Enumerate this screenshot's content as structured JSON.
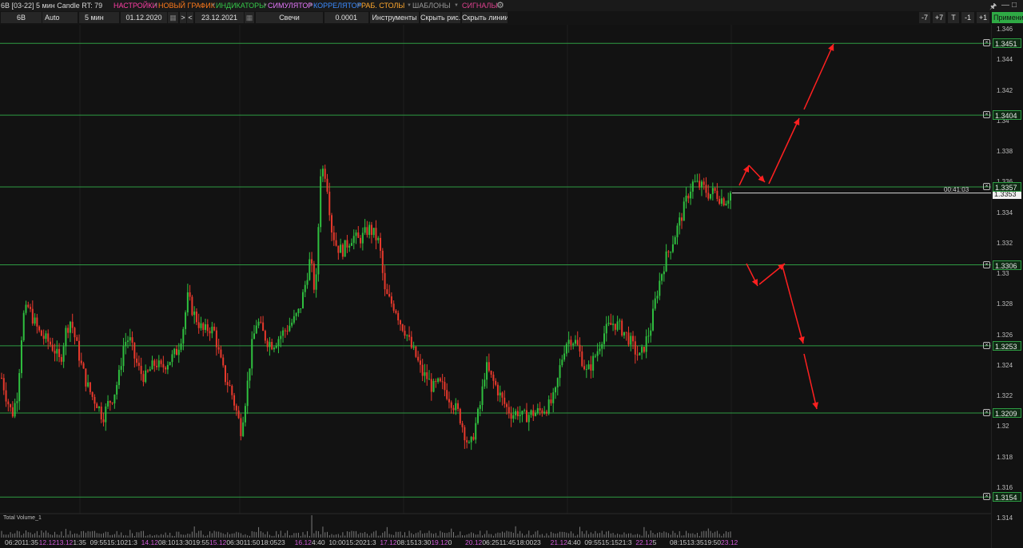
{
  "menubar": {
    "instrument_title": "6B [03-22] 5 мин Candle RT: 79",
    "items": [
      {
        "label": "НАСТРОЙКИ",
        "color": "#ff3ea5"
      },
      {
        "label": "НОВЫЙ ГРАФИК",
        "color": "#ff7a1a"
      },
      {
        "label": "ИНДИКАТОРЫ",
        "color": "#35c84a"
      },
      {
        "label": "СИМУЛЯТОР",
        "color": "#e879ff"
      },
      {
        "label": "КОРРЕЛЯТОР",
        "color": "#3c8cff"
      },
      {
        "label": "РАБ. СТОЛЫ",
        "color": "#ffa82e"
      },
      {
        "label": "ШАБЛОНЫ",
        "color": "#9a9a9a"
      },
      {
        "label": "СИГНАЛЫ",
        "color": "#e0418f"
      }
    ],
    "gear_icon": "gear-icon",
    "window_controls": [
      "pin-icon",
      "minimize-icon",
      "maximize-icon",
      "close-icon"
    ]
  },
  "toolbar": {
    "symbol": "6B",
    "scale_mode": "Auto",
    "timeframe": "5 мин",
    "date_from": "01.12.2020",
    "next_label": ">",
    "prev_label": "<",
    "date_to": "23.12.2021",
    "chart_type": "Свечи",
    "tick_size": "0.0001",
    "instruments_label": "Инструменты",
    "hide_drawings_label": "Скрыть рис.",
    "hide_lines_label": "Скрыть линии",
    "right_buttons": [
      "-7",
      "+7",
      "T",
      "-1",
      "+1"
    ],
    "apply_label": "Применить"
  },
  "price_axis": {
    "ticks": [
      "1.346",
      "1.344",
      "1.342",
      "1.34",
      "1.338",
      "1.336",
      "1.334",
      "1.332",
      "1.33",
      "1.328",
      "1.326",
      "1.324",
      "1.322",
      "1.32",
      "1.318",
      "1.316",
      "1.314"
    ],
    "level_labels": [
      "1.3451",
      "1.3404",
      "1.3357",
      "1.3306",
      "1.3253",
      "1.3209",
      "1.3154"
    ],
    "current_price": "1.3353",
    "bar_timer": "00:41:03"
  },
  "time_axis": {
    "labels": [
      {
        "text": "06:20",
        "date": false
      },
      {
        "text": "11:35",
        "date": false
      },
      {
        "text": "12.12",
        "date": true
      },
      {
        "text": "13.12",
        "date": true
      },
      {
        "text": "1:35",
        "date": false
      },
      {
        "text": "09:55",
        "date": false
      },
      {
        "text": "15:10",
        "date": false
      },
      {
        "text": "21:3",
        "date": false
      },
      {
        "text": "14.12",
        "date": true
      },
      {
        "text": "08:10",
        "date": false
      },
      {
        "text": "13:30",
        "date": false
      },
      {
        "text": "19:55",
        "date": false
      },
      {
        "text": "15.12",
        "date": true
      },
      {
        "text": "06:30",
        "date": false
      },
      {
        "text": "11:50",
        "date": false
      },
      {
        "text": "18:05",
        "date": false
      },
      {
        "text": "23",
        "date": false
      },
      {
        "text": "16.12",
        "date": true
      },
      {
        "text": "4:40",
        "date": false
      },
      {
        "text": "10:00",
        "date": false
      },
      {
        "text": "15:20",
        "date": false
      },
      {
        "text": "21:3",
        "date": false
      },
      {
        "text": "17.12",
        "date": true
      },
      {
        "text": "08:15",
        "date": false
      },
      {
        "text": "13:30",
        "date": false
      },
      {
        "text": "19.12",
        "date": true
      },
      {
        "text": "0",
        "date": false
      },
      {
        "text": "20.12",
        "date": true
      },
      {
        "text": "06:25",
        "date": false
      },
      {
        "text": "11:45",
        "date": false
      },
      {
        "text": "18:00",
        "date": false
      },
      {
        "text": "23",
        "date": false
      },
      {
        "text": "21.12",
        "date": true
      },
      {
        "text": "4:40",
        "date": false
      },
      {
        "text": "09:55",
        "date": false
      },
      {
        "text": "15:15",
        "date": false
      },
      {
        "text": "21:3",
        "date": false
      },
      {
        "text": "22.12",
        "date": true
      },
      {
        "text": "5",
        "date": false
      },
      {
        "text": "08:15",
        "date": false
      },
      {
        "text": "13:35",
        "date": false
      },
      {
        "text": "19:50",
        "date": false
      },
      {
        "text": "23.12",
        "date": true
      }
    ]
  },
  "volume_panel": {
    "label": "Total Volume_1"
  },
  "colors": {
    "background": "#121212",
    "up_candle": "#2fbf3f",
    "down_candle": "#e8392c",
    "level_line": "#2e9b43",
    "arrow": "#ff2020",
    "date_label": "#d05ad8"
  },
  "chart_data": {
    "type": "candlestick",
    "ylim": [
      1.3125,
      1.347
    ],
    "horizontal_levels": [
      1.3451,
      1.3404,
      1.3357,
      1.3306,
      1.3253,
      1.3209,
      1.3154
    ],
    "last_price": 1.3353,
    "close_path": [
      1.3232,
      1.3218,
      1.3208,
      1.3222,
      1.3272,
      1.3278,
      1.327,
      1.3262,
      1.3258,
      1.3255,
      1.325,
      1.3242,
      1.3262,
      1.327,
      1.3255,
      1.324,
      1.3228,
      1.322,
      1.3215,
      1.3206,
      1.3215,
      1.322,
      1.3232,
      1.3255,
      1.3258,
      1.3245,
      1.3236,
      1.3232,
      1.3238,
      1.3242,
      1.3238,
      1.3242,
      1.3245,
      1.325,
      1.3262,
      1.3285,
      1.3275,
      1.3268,
      1.3262,
      1.3265,
      1.3262,
      1.3245,
      1.3232,
      1.3225,
      1.3212,
      1.3198,
      1.3222,
      1.3252,
      1.327,
      1.3262,
      1.3256,
      1.3254,
      1.3258,
      1.3262,
      1.3266,
      1.327,
      1.3276,
      1.3292,
      1.331,
      1.3285,
      1.337,
      1.3365,
      1.333,
      1.3318,
      1.3315,
      1.332,
      1.3325,
      1.3322,
      1.3325,
      1.333,
      1.3326,
      1.332,
      1.3288,
      1.3282,
      1.3278,
      1.3268,
      1.3262,
      1.3252,
      1.3245,
      1.3235,
      1.3232,
      1.3225,
      1.3228,
      1.3226,
      1.322,
      1.3214,
      1.3208,
      1.3196,
      1.3185,
      1.32,
      1.3215,
      1.324,
      1.3232,
      1.3226,
      1.3218,
      1.3212,
      1.3208,
      1.321,
      1.3206,
      1.3208,
      1.3209,
      1.321,
      1.3212,
      1.3214,
      1.322,
      1.324,
      1.3255,
      1.3258,
      1.3255,
      1.3245,
      1.3235,
      1.3242,
      1.325,
      1.326,
      1.3265,
      1.3268,
      1.3266,
      1.3262,
      1.3257,
      1.325,
      1.3245,
      1.3255,
      1.3265,
      1.3285,
      1.33,
      1.3312,
      1.332,
      1.333,
      1.334,
      1.3352,
      1.336,
      1.3358,
      1.3356,
      1.3352,
      1.3354,
      1.335,
      1.3348,
      1.3353
    ]
  }
}
